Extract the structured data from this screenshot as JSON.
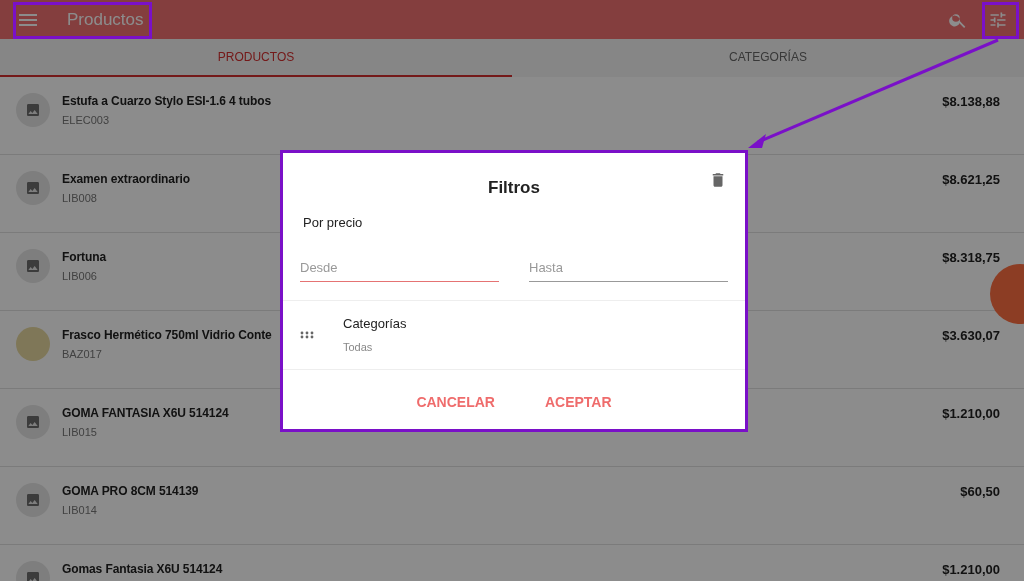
{
  "app_bar": {
    "title": "Productos"
  },
  "tabs": [
    {
      "label": "PRODUCTOS",
      "selected": true
    },
    {
      "label": "CATEGORÍAS",
      "selected": false
    }
  ],
  "products": [
    {
      "name": "Estufa a Cuarzo Stylo ESI-1.6 4 tubos",
      "code": "ELEC003",
      "price": "$8.138,88",
      "kind": "icon"
    },
    {
      "name": "Examen extraordinario",
      "code": "LIB008",
      "price": "$8.621,25",
      "kind": "icon"
    },
    {
      "name": "Fortuna",
      "code": "LIB006",
      "price": "$8.318,75",
      "kind": "icon"
    },
    {
      "name": "Frasco Hermético 750ml Vidrio Conte",
      "code": "BAZ017",
      "price": "$3.630,07",
      "kind": "photo"
    },
    {
      "name": "GOMA FANTASIA X6U 514124",
      "code": "LIB015",
      "price": "$1.210,00",
      "kind": "icon"
    },
    {
      "name": "GOMA PRO 8CM 514139",
      "code": "LIB014",
      "price": "$60,50",
      "kind": "icon"
    },
    {
      "name": "Gomas Fantasia X6U 514124",
      "price": "$1.210,00",
      "kind": "icon"
    }
  ],
  "dialog": {
    "title": "Filtros",
    "section": "Por precio",
    "fields": [
      {
        "placeholder": "Desde",
        "focused": true
      },
      {
        "placeholder": "Hasta",
        "focused": false
      }
    ],
    "category": {
      "label": "Categorías",
      "value": "Todas"
    },
    "buttons": [
      "CANCELAR",
      "ACEPTAR"
    ]
  }
}
